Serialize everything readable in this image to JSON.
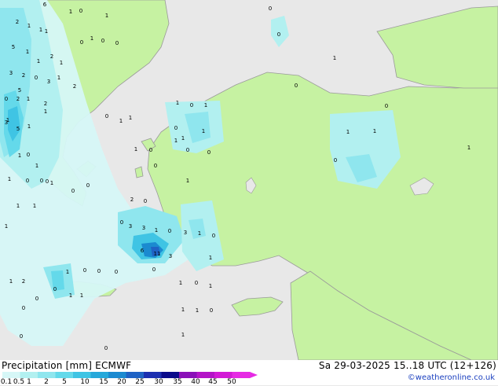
{
  "title": {
    "left": "Precipitation [mm] ECMWF",
    "right": "Sa 29-03-2025 15..18 UTC (12+126)"
  },
  "credit": "©weatheronline.co.uk",
  "colors": {
    "sea": "#e8e8e8",
    "land": "#c6f2a2",
    "border": "#a8a8a8"
  },
  "legend": {
    "ticks": [
      "0.1",
      "0.5",
      "1",
      "2",
      "5",
      "10",
      "15",
      "20",
      "25",
      "30",
      "35",
      "40",
      "45",
      "50"
    ],
    "colors": [
      "#d6f7f7",
      "#b2f0f0",
      "#8fe6ee",
      "#64d9ea",
      "#3fc4e4",
      "#26a8da",
      "#1b8ad0",
      "#1f62c4",
      "#1c2fb0",
      "#0a0a8a",
      "#8a10b8",
      "#b414c8",
      "#d21ad6",
      "#e62ae4"
    ]
  },
  "map_values": [
    "6",
    "1",
    "2",
    "1",
    "1",
    "0",
    "1",
    "5",
    "1",
    "1",
    "2",
    "1",
    "3",
    "2",
    "1",
    "0",
    "5",
    "1",
    "2",
    "3",
    "1",
    "2",
    "0",
    "1",
    "0",
    "0",
    "0",
    "2",
    "1",
    "5",
    "1",
    "1",
    "1",
    "0",
    "1",
    "0",
    "3",
    "0",
    "1",
    "1",
    "1",
    "1",
    "1",
    "1",
    "0",
    "1",
    "1",
    "1",
    "1",
    "0",
    "1",
    "0",
    "1",
    "0",
    "1",
    "1",
    "0",
    "0",
    "0",
    "0",
    "0",
    "0",
    "1",
    "0",
    "1",
    "1",
    "0",
    "2",
    "0",
    "0",
    "3",
    "3",
    "1",
    "0",
    "3",
    "1",
    "0",
    "6",
    "11",
    "3",
    "0",
    "1",
    "0",
    "1",
    "0",
    "0",
    "0",
    "1",
    "0",
    "1",
    "1",
    "2",
    "1",
    "0",
    "0",
    "1",
    "1",
    "0",
    "0",
    "0",
    "1",
    "1",
    "1",
    "0",
    "0",
    "0"
  ]
}
